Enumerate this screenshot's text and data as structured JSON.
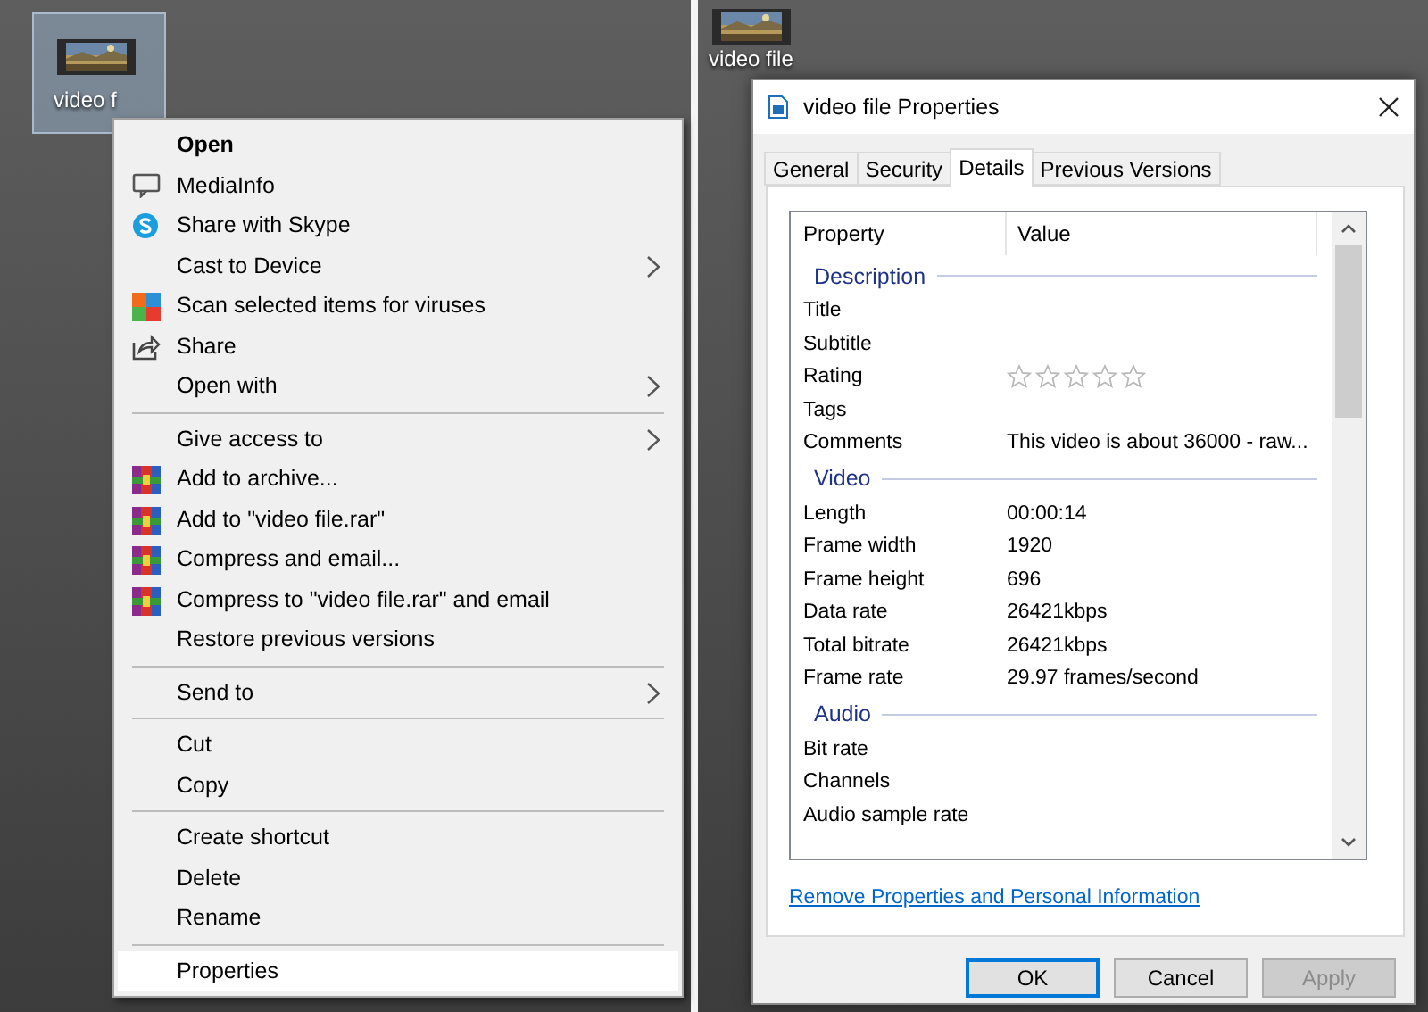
{
  "left_desktop": {
    "icon": {
      "label": "video f",
      "selected": true
    },
    "context_menu": {
      "groups": [
        [
          {
            "label": "Open",
            "kind": "default",
            "submenu": false,
            "selected": false
          },
          {
            "label": "MediaInfo",
            "kind": "command",
            "submenu": false,
            "selected": false
          },
          {
            "label": "Share with Skype",
            "kind": "command",
            "submenu": false,
            "selected": false
          },
          {
            "label": "Cast to Device",
            "kind": "command",
            "submenu": true,
            "selected": false
          },
          {
            "label": "Scan selected items for viruses",
            "kind": "command",
            "submenu": false,
            "selected": false
          },
          {
            "label": "Share",
            "kind": "command",
            "submenu": false,
            "selected": false
          },
          {
            "label": "Open with",
            "kind": "command",
            "submenu": true,
            "selected": false
          }
        ],
        [
          {
            "label": "Give access to",
            "kind": "command",
            "submenu": true,
            "selected": false
          },
          {
            "label": "Add to archive...",
            "kind": "command",
            "submenu": false,
            "selected": false
          },
          {
            "label": "Add to \"video file.rar\"",
            "kind": "command",
            "submenu": false,
            "selected": false
          },
          {
            "label": "Compress and email...",
            "kind": "command",
            "submenu": false,
            "selected": false
          },
          {
            "label": "Compress to \"video file.rar\" and email",
            "kind": "command",
            "submenu": false,
            "selected": false
          },
          {
            "label": "Restore previous versions",
            "kind": "command",
            "submenu": false,
            "selected": false
          }
        ],
        [
          {
            "label": "Send to",
            "kind": "command",
            "submenu": true,
            "selected": false
          }
        ],
        [
          {
            "label": "Cut",
            "kind": "command",
            "submenu": false,
            "selected": false
          },
          {
            "label": "Copy",
            "kind": "command",
            "submenu": false,
            "selected": false
          }
        ],
        [
          {
            "label": "Create shortcut",
            "kind": "command",
            "submenu": false,
            "selected": false
          },
          {
            "label": "Delete",
            "kind": "command",
            "submenu": false,
            "selected": false
          },
          {
            "label": "Rename",
            "kind": "command",
            "submenu": false,
            "selected": false
          }
        ],
        [
          {
            "label": "Properties",
            "kind": "command",
            "submenu": false,
            "selected": true
          }
        ]
      ]
    }
  },
  "right_desktop": {
    "icon": {
      "label": "video file"
    },
    "dialog": {
      "title": "video file Properties",
      "tabs": [
        {
          "label": "General",
          "selected": false
        },
        {
          "label": "Security",
          "selected": false
        },
        {
          "label": "Details",
          "selected": true
        },
        {
          "label": "Previous Versions",
          "selected": false
        }
      ],
      "columns": [
        "Property",
        "Value"
      ],
      "sections": [
        {
          "name": "Description",
          "rows": [
            {
              "kind": "text",
              "property": "Title"
            },
            {
              "kind": "text",
              "property": "Subtitle"
            },
            {
              "kind": "rating",
              "property": "Rating",
              "stars": 0
            },
            {
              "kind": "text",
              "property": "Tags"
            },
            {
              "kind": "text",
              "property": "Comments",
              "value": "This video is about 36000 - raw..."
            }
          ]
        },
        {
          "name": "Video",
          "rows": [
            {
              "kind": "text",
              "property": "Length",
              "value": "00:00:14"
            },
            {
              "kind": "text",
              "property": "Frame width",
              "value": "1920"
            },
            {
              "kind": "text",
              "property": "Frame height",
              "value": "696"
            },
            {
              "kind": "text",
              "property": "Data rate",
              "value": "26421kbps"
            },
            {
              "kind": "text",
              "property": "Total bitrate",
              "value": "26421kbps"
            },
            {
              "kind": "text",
              "property": "Frame rate",
              "value": "29.97 frames/second"
            }
          ]
        },
        {
          "name": "Audio",
          "rows": [
            {
              "kind": "text",
              "property": "Bit rate"
            },
            {
              "kind": "text",
              "property": "Channels"
            },
            {
              "kind": "text",
              "property": "Audio sample rate"
            }
          ]
        }
      ],
      "link": "Remove Properties and Personal Information",
      "buttons": [
        {
          "label": "OK",
          "kind": "default",
          "disabled": false
        },
        {
          "label": "Cancel",
          "kind": "normal",
          "disabled": false
        },
        {
          "label": "Apply",
          "kind": "normal",
          "disabled": true
        }
      ]
    }
  }
}
